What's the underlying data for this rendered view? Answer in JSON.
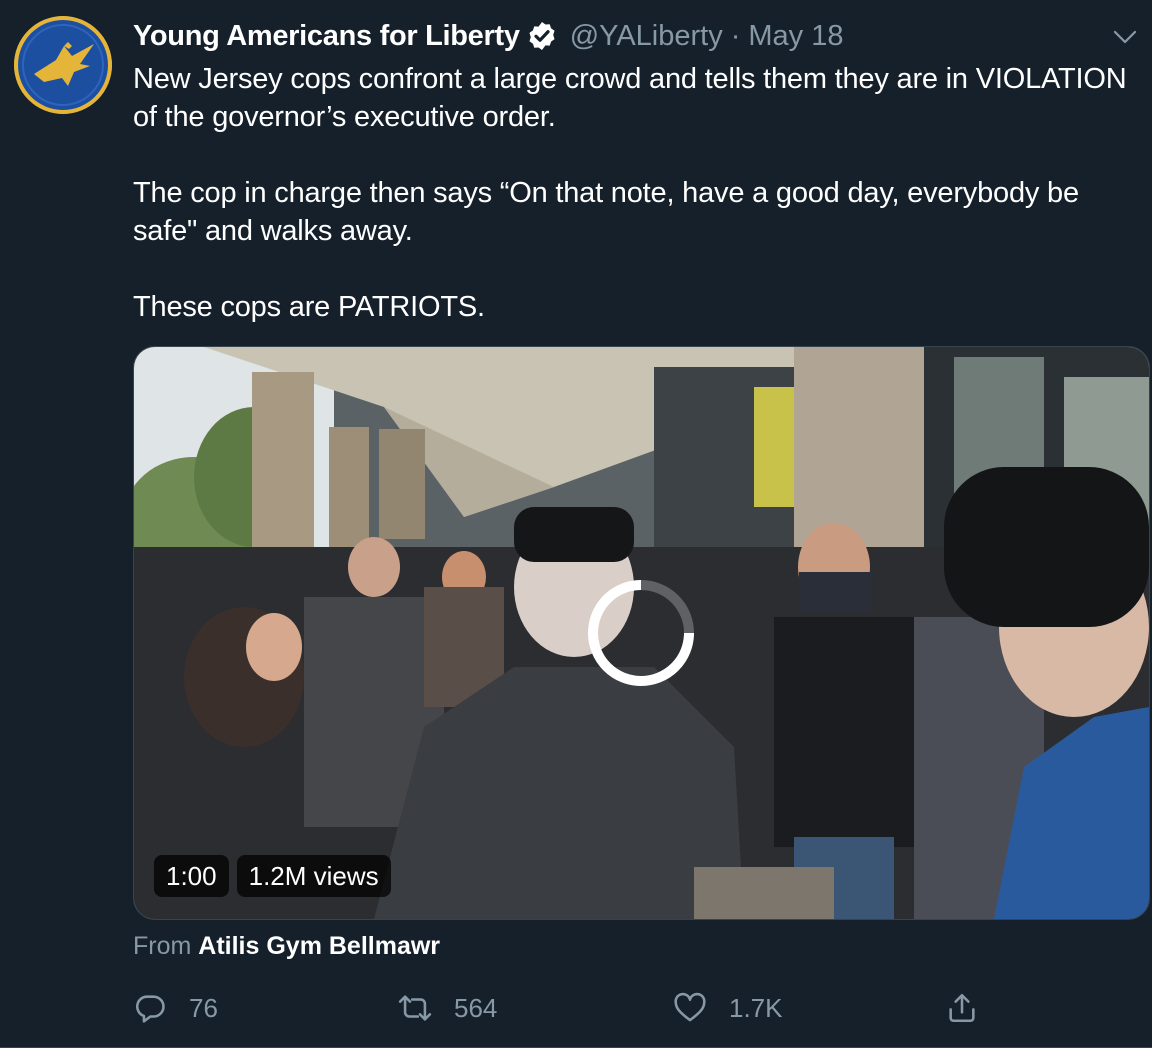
{
  "tweet": {
    "display_name": "Young Americans for Liberty",
    "handle": "@YALiberty",
    "separator": "·",
    "date": "May 18",
    "paragraphs": [
      "New Jersey cops confront a large crowd and tells them they are in VIOLATION of the governor’s executive order.",
      "The cop in charge then says “On that note, have a good day, everybody be safe\" and walks away.",
      "These cops are PATRIOTS."
    ],
    "video": {
      "duration": "1:00",
      "views": "1.2M views"
    },
    "source": {
      "prefix": "From",
      "name": "Atilis Gym Bellmawr"
    },
    "actions": {
      "replies": "76",
      "retweets": "564",
      "likes": "1.7K"
    }
  },
  "icons": {
    "verified": "verified-badge-icon",
    "more": "chevron-down-icon",
    "reply": "reply-icon",
    "retweet": "retweet-icon",
    "like": "heart-icon",
    "share": "share-icon",
    "loading": "loading-spinner-icon"
  },
  "colors": {
    "background": "#15202b",
    "secondary_text": "#8899a6",
    "border": "#38444d",
    "avatar_ring": "#e5b53a",
    "avatar_fill": "#1d4fa0"
  }
}
